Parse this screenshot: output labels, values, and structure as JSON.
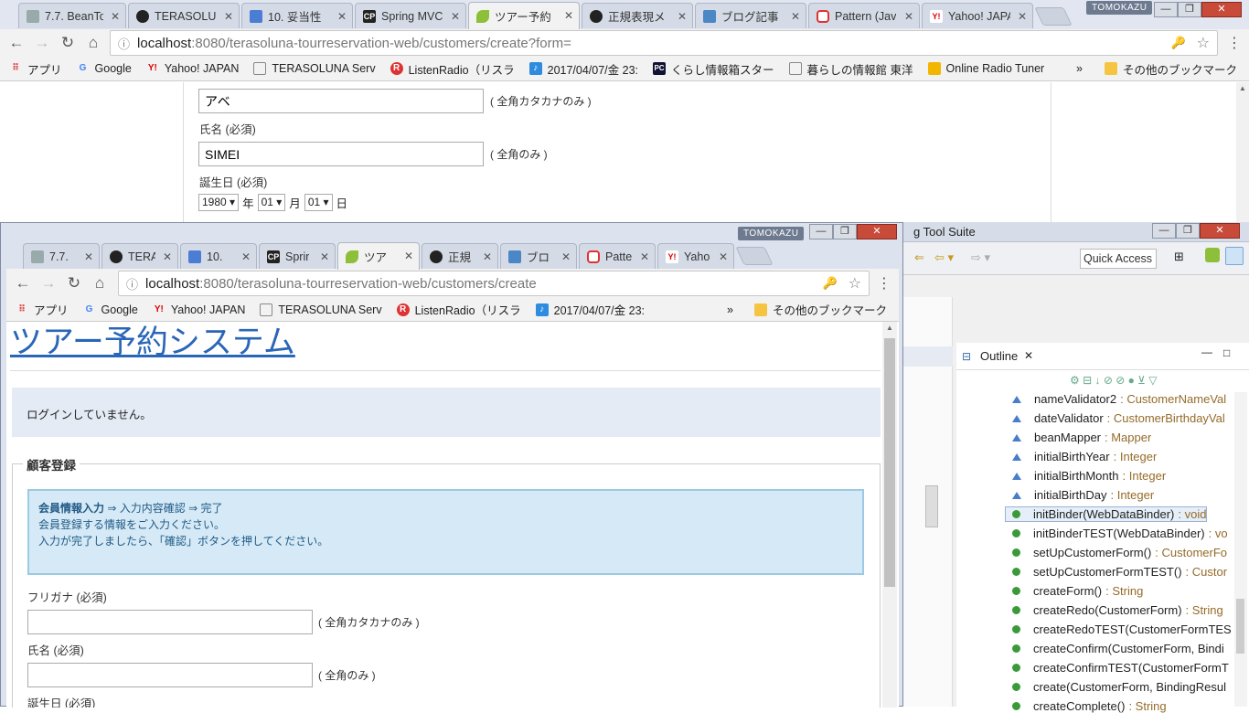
{
  "back_window": {
    "profile": "TOMOKAZU",
    "tabs": [
      {
        "label": "7.7. BeanTo",
        "icon": "page-icon"
      },
      {
        "label": "TERASOLUNA",
        "icon": "github-icon"
      },
      {
        "label": "10. 妥当性",
        "icon": "doc-icon"
      },
      {
        "label": "Spring MVC",
        "icon": "cp-icon"
      },
      {
        "label": "ツアー予約",
        "icon": "leaf-icon"
      },
      {
        "label": "正規表現メ",
        "icon": "github-icon"
      },
      {
        "label": "ブログ記事",
        "icon": "wrench-icon"
      },
      {
        "label": "Pattern (Jav",
        "icon": "oracle-icon"
      },
      {
        "label": "Yahoo! JAPA",
        "icon": "yahoo-icon"
      }
    ],
    "url_host": "localhost",
    "url_path": ":8080/terasoluna-tourreservation-web/customers/create?form=",
    "bookmarks": [
      "アプリ",
      "Google",
      "Yahoo! JAPAN",
      "TERASOLUNA Serv",
      "ListenRadio（リスラ",
      "2017/04/07/金 23:",
      "くらし情報箱スター",
      "暮らしの情報館 東洋",
      "Online Radio Tuner"
    ],
    "bookmarks_more": "»",
    "other_bookmarks": "その他のブックマーク",
    "form": {
      "kana_value": "アベ",
      "kana_hint": "( 全角カタカナのみ )",
      "name_label": "氏名 (必須)",
      "name_value": "SIMEI",
      "name_hint": "( 全角のみ )",
      "birth_label": "誕生日 (必須)",
      "year": "1980",
      "year_unit": "年",
      "month": "01",
      "month_unit": "月",
      "day": "01",
      "day_unit": "日"
    }
  },
  "eclipse": {
    "title": "g Tool Suite",
    "quick_access": "Quick Access",
    "outline_title": "Outline",
    "outline_items": [
      {
        "name": "nameValidator2",
        "type": ": CustomerNameVal",
        "kind": "field"
      },
      {
        "name": "dateValidator",
        "type": ": CustomerBirthdayVal",
        "kind": "field"
      },
      {
        "name": "beanMapper",
        "type": ": Mapper",
        "kind": "field"
      },
      {
        "name": "initialBirthYear",
        "type": ": Integer",
        "kind": "field"
      },
      {
        "name": "initialBirthMonth",
        "type": ": Integer",
        "kind": "field"
      },
      {
        "name": "initialBirthDay",
        "type": ": Integer",
        "kind": "field"
      },
      {
        "name": "initBinder(WebDataBinder)",
        "type": ": void",
        "kind": "method"
      },
      {
        "name": "initBinderTEST(WebDataBinder)",
        "type": ": vo",
        "kind": "method"
      },
      {
        "name": "setUpCustomerForm()",
        "type": ": CustomerFo",
        "kind": "method"
      },
      {
        "name": "setUpCustomerFormTEST()",
        "type": ": Custor",
        "kind": "method"
      },
      {
        "name": "createForm()",
        "type": ": String",
        "kind": "method"
      },
      {
        "name": "createRedo(CustomerForm)",
        "type": ": String",
        "kind": "method"
      },
      {
        "name": "createRedoTEST(CustomerFormTES",
        "type": "",
        "kind": "method"
      },
      {
        "name": "createConfirm(CustomerForm, Bindi",
        "type": "",
        "kind": "method"
      },
      {
        "name": "createConfirmTEST(CustomerFormT",
        "type": "",
        "kind": "method"
      },
      {
        "name": "create(CustomerForm, BindingResul",
        "type": "",
        "kind": "method"
      },
      {
        "name": "createComplete()",
        "type": ": String",
        "kind": "method"
      }
    ]
  },
  "front_window": {
    "profile": "TOMOKAZU",
    "tabs": [
      {
        "label": "7.7.",
        "icon": "page-icon"
      },
      {
        "label": "TERA",
        "icon": "github-icon"
      },
      {
        "label": "10.",
        "icon": "doc-icon"
      },
      {
        "label": "Sprir",
        "icon": "cp-icon"
      },
      {
        "label": "ツア",
        "icon": "leaf-icon"
      },
      {
        "label": "正規",
        "icon": "github-icon"
      },
      {
        "label": "ブロ",
        "icon": "wrench-icon"
      },
      {
        "label": "Patte",
        "icon": "oracle-icon"
      },
      {
        "label": "Yaho",
        "icon": "yahoo-icon"
      }
    ],
    "url_host": "localhost",
    "url_path": ":8080/terasoluna-tourreservation-web/customers/create",
    "bookmarks": [
      "アプリ",
      "Google",
      "Yahoo! JAPAN",
      "TERASOLUNA Serv",
      "ListenRadio（リスラ",
      "2017/04/07/金 23:"
    ],
    "bookmarks_more": "»",
    "other_bookmarks": "その他のブックマーク",
    "page": {
      "site_title": "ツアー予約システム",
      "login_status": "ログインしていません。",
      "section_title": "顧客登録",
      "step_current": "会員情報入力",
      "step_rest": " ⇒ 入力内容確認 ⇒ 完了",
      "info_line1": "会員登録する情報をご入力ください。",
      "info_line2": "入力が完了しましたら、「確認」ボタンを押してください。",
      "kana_label": "フリガナ (必須)",
      "kana_hint": "( 全角カタカナのみ )",
      "name_label": "氏名 (必須)",
      "name_hint": "( 全角のみ )",
      "birth_label": "誕生日 (必須)"
    }
  }
}
